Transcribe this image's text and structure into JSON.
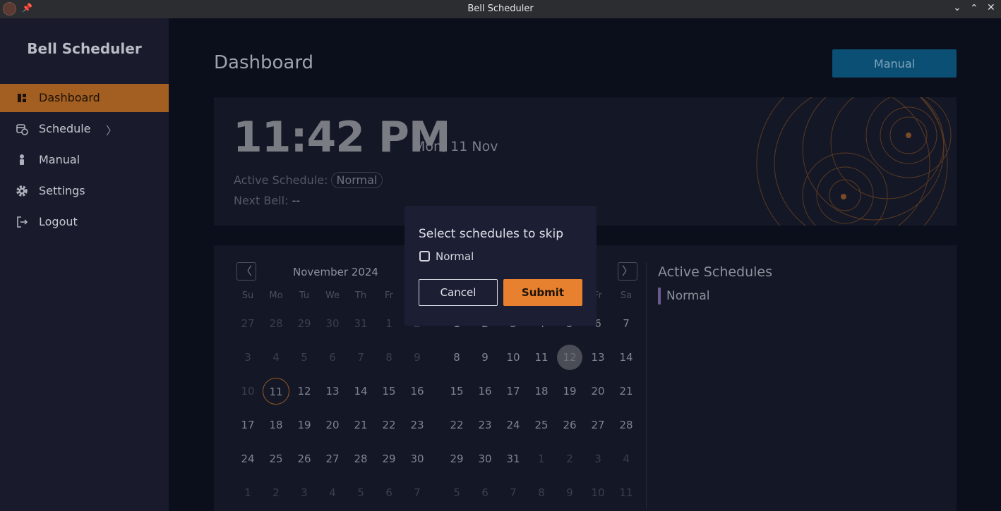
{
  "window": {
    "title": "Bell Scheduler",
    "controls": [
      "chevron-down-icon",
      "chevron-up-icon",
      "close-icon"
    ]
  },
  "sidebar": {
    "brand": "Bell Scheduler",
    "items": [
      {
        "label": "Dashboard",
        "icon": "dashboard-icon",
        "active": true
      },
      {
        "label": "Schedule",
        "icon": "calendar-clock-icon",
        "has_submenu": true
      },
      {
        "label": "Manual",
        "icon": "person-icon"
      },
      {
        "label": "Settings",
        "icon": "gear-icon"
      },
      {
        "label": "Logout",
        "icon": "logout-icon"
      }
    ]
  },
  "header": {
    "title": "Dashboard",
    "manual_button": "Manual"
  },
  "clock": {
    "time": "11:42 PM",
    "date": "Mon, 11 Nov",
    "active_schedule_label": "Active Schedule:",
    "active_schedule_value": "Normal",
    "next_bell_label": "Next Bell:",
    "next_bell_value": "--"
  },
  "calendar": {
    "month_title": "November 2024",
    "weekdays": [
      "Su",
      "Mo",
      "Tu",
      "We",
      "Th",
      "Fr",
      "Sa"
    ],
    "left_month_weeks": [
      [
        "27",
        "28",
        "29",
        "30",
        "31",
        "1",
        "2"
      ],
      [
        "3",
        "4",
        "5",
        "6",
        "7",
        "8",
        "9"
      ],
      [
        "10",
        "11",
        "12",
        "13",
        "14",
        "15",
        "16"
      ],
      [
        "17",
        "18",
        "19",
        "20",
        "21",
        "22",
        "23"
      ],
      [
        "24",
        "25",
        "26",
        "27",
        "28",
        "29",
        "30"
      ],
      [
        "1",
        "2",
        "3",
        "4",
        "5",
        "6",
        "7"
      ]
    ],
    "right_month_weeks": [
      [
        "1",
        "2",
        "3",
        "4",
        "5",
        "6",
        "7"
      ],
      [
        "8",
        "9",
        "10",
        "11",
        "12",
        "13",
        "14"
      ],
      [
        "15",
        "16",
        "17",
        "18",
        "19",
        "20",
        "21"
      ],
      [
        "22",
        "23",
        "24",
        "25",
        "26",
        "27",
        "28"
      ],
      [
        "29",
        "30",
        "31",
        "1",
        "2",
        "3",
        "4"
      ],
      [
        "5",
        "6",
        "7",
        "8",
        "9",
        "10",
        "11"
      ]
    ],
    "today": "11",
    "selected_right": "12"
  },
  "active_schedules": {
    "title": "Active Schedules",
    "items": [
      "Normal"
    ]
  },
  "modal": {
    "title": "Select schedules to skip",
    "options": [
      {
        "label": "Normal",
        "checked": false
      }
    ],
    "cancel_label": "Cancel",
    "submit_label": "Submit"
  },
  "colors": {
    "accent": "#e8812f",
    "sidebar_active": "#a35e22",
    "manual_button": "#0b4f74",
    "schedule_marker": "#6d5a8d"
  }
}
